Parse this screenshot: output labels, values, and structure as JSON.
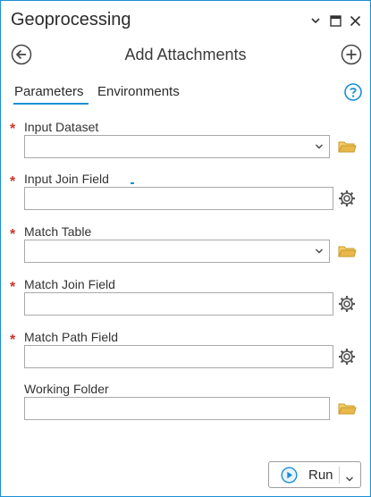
{
  "window": {
    "title": "Geoprocessing",
    "controls": [
      "chevron-down-icon",
      "restore-icon",
      "close-icon"
    ]
  },
  "tool": {
    "title": "Add Attachments",
    "back_icon": "back-arrow-icon",
    "add_icon": "add-icon"
  },
  "tabs": [
    {
      "label": "Parameters",
      "active": true
    },
    {
      "label": "Environments",
      "active": false
    }
  ],
  "help_icon": "help-icon",
  "params": [
    {
      "label": "Input Dataset",
      "required": true,
      "type": "dropdown",
      "icon": "folder-icon",
      "value": ""
    },
    {
      "label": "Input Join Field",
      "required": true,
      "type": "field",
      "icon": "gear-icon",
      "value": ""
    },
    {
      "label": "Match Table",
      "required": true,
      "type": "dropdown",
      "icon": "folder-icon",
      "value": ""
    },
    {
      "label": "Match Join Field",
      "required": true,
      "type": "field",
      "icon": "gear-icon",
      "value": ""
    },
    {
      "label": "Match Path Field",
      "required": true,
      "type": "field",
      "icon": "gear-icon",
      "value": ""
    },
    {
      "label": "Working Folder",
      "required": false,
      "type": "text",
      "icon": "folder-icon",
      "value": ""
    }
  ],
  "required_marker": "*",
  "run": {
    "label": "Run"
  },
  "colors": {
    "accent": "#1a8fd6",
    "required": "#c7362a",
    "folder": "#e8b84a"
  }
}
